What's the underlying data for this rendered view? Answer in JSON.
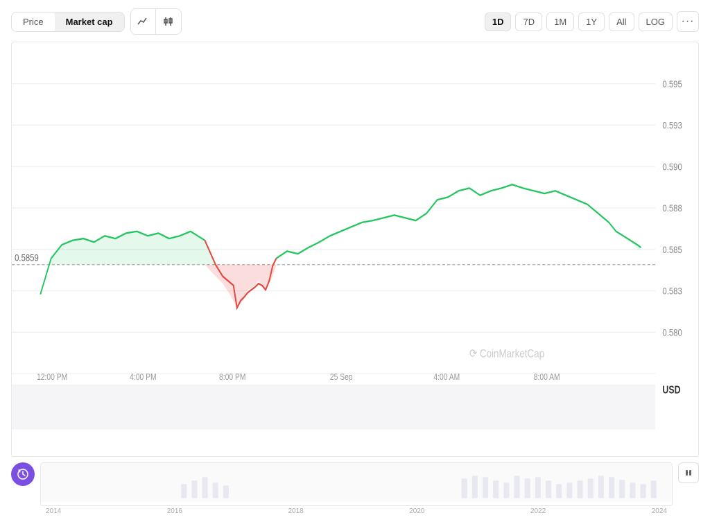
{
  "toolbar": {
    "tabs": [
      {
        "label": "Price",
        "active": false
      },
      {
        "label": "Market cap",
        "active": true
      }
    ],
    "chart_type_line": "∿",
    "chart_type_candle": "⬧⬧",
    "time_periods": [
      {
        "label": "1D",
        "active": true
      },
      {
        "label": "7D",
        "active": false
      },
      {
        "label": "1M",
        "active": false
      },
      {
        "label": "1Y",
        "active": false
      },
      {
        "label": "All",
        "active": false
      }
    ],
    "log_label": "LOG",
    "more_label": "···"
  },
  "chart": {
    "reference_price": "0.5859",
    "y_axis_labels": [
      "0.595",
      "0.593",
      "0.590",
      "0.588",
      "0.585",
      "0.583",
      "0.580"
    ],
    "currency": "USD",
    "watermark": "CoinMarketCap",
    "x_axis_labels": [
      "12:00 PM",
      "4:00 PM",
      "8:00 PM",
      "25 Sep",
      "4:00 AM",
      "8:00 AM"
    ]
  },
  "bottom": {
    "clock_icon": "⏱",
    "mini_year_labels": [
      "2014",
      "2016",
      "2018",
      "2020",
      "2022",
      "2024"
    ],
    "pause_icon": "⏸"
  }
}
